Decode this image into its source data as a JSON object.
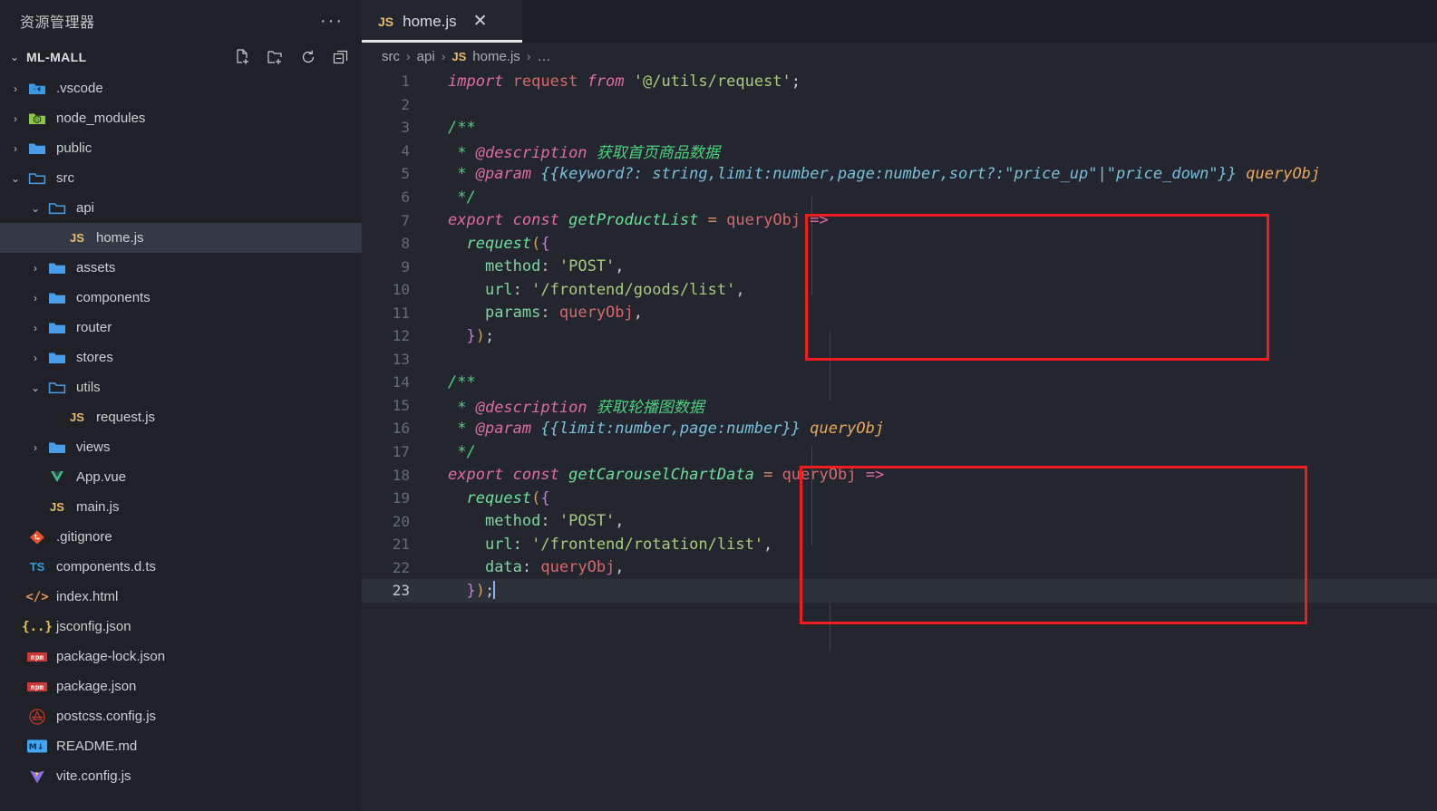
{
  "sidebar": {
    "title": "资源管理器",
    "more_label": "···",
    "root": {
      "label": "ML-MALL",
      "twisty": "⌄",
      "actions": [
        {
          "name": "new-file-icon",
          "label": "New File"
        },
        {
          "name": "new-folder-icon",
          "label": "New Folder"
        },
        {
          "name": "refresh-icon",
          "label": "Refresh Explorer"
        },
        {
          "name": "collapse-all-icon",
          "label": "Collapse Folders in Explorer"
        }
      ]
    },
    "items": [
      {
        "label": ".vscode",
        "icon": "vscode-folder-icon",
        "indent": 1,
        "twisty": "›",
        "type": "folder",
        "selected": false
      },
      {
        "label": "node_modules",
        "icon": "node-folder-icon",
        "indent": 1,
        "twisty": "›",
        "type": "folder",
        "selected": false
      },
      {
        "label": "public",
        "icon": "folder-icon",
        "indent": 1,
        "twisty": "›",
        "type": "folder",
        "selected": false
      },
      {
        "label": "src",
        "icon": "folder-open-icon",
        "indent": 1,
        "twisty": "⌄",
        "type": "folder",
        "selected": false
      },
      {
        "label": "api",
        "icon": "folder-open-icon",
        "indent": 2,
        "twisty": "⌄",
        "type": "folder",
        "selected": false
      },
      {
        "label": "home.js",
        "icon": "js-file-icon",
        "indent": 3,
        "twisty": "",
        "type": "file",
        "selected": true
      },
      {
        "label": "assets",
        "icon": "folder-icon",
        "indent": 2,
        "twisty": "›",
        "type": "folder",
        "selected": false
      },
      {
        "label": "components",
        "icon": "folder-icon",
        "indent": 2,
        "twisty": "›",
        "type": "folder",
        "selected": false
      },
      {
        "label": "router",
        "icon": "folder-icon",
        "indent": 2,
        "twisty": "›",
        "type": "folder",
        "selected": false
      },
      {
        "label": "stores",
        "icon": "folder-icon",
        "indent": 2,
        "twisty": "›",
        "type": "folder",
        "selected": false
      },
      {
        "label": "utils",
        "icon": "folder-open-icon",
        "indent": 2,
        "twisty": "⌄",
        "type": "folder",
        "selected": false
      },
      {
        "label": "request.js",
        "icon": "js-file-icon",
        "indent": 3,
        "twisty": "",
        "type": "file",
        "selected": false
      },
      {
        "label": "views",
        "icon": "folder-icon",
        "indent": 2,
        "twisty": "›",
        "type": "folder",
        "selected": false
      },
      {
        "label": "App.vue",
        "icon": "vue-file-icon",
        "indent": 2,
        "twisty": "",
        "type": "file",
        "selected": false
      },
      {
        "label": "main.js",
        "icon": "js-file-icon",
        "indent": 2,
        "twisty": "",
        "type": "file",
        "selected": false
      },
      {
        "label": ".gitignore",
        "icon": "git-file-icon",
        "indent": 1,
        "twisty": "",
        "type": "file",
        "selected": false
      },
      {
        "label": "components.d.ts",
        "icon": "ts-file-icon",
        "indent": 1,
        "twisty": "",
        "type": "file",
        "selected": false
      },
      {
        "label": "index.html",
        "icon": "html-file-icon",
        "indent": 1,
        "twisty": "",
        "type": "file",
        "selected": false
      },
      {
        "label": "jsconfig.json",
        "icon": "json-file-icon",
        "indent": 1,
        "twisty": "",
        "type": "file",
        "selected": false
      },
      {
        "label": "package-lock.json",
        "icon": "npm-file-icon",
        "indent": 1,
        "twisty": "",
        "type": "file",
        "selected": false
      },
      {
        "label": "package.json",
        "icon": "npm-file-icon",
        "indent": 1,
        "twisty": "",
        "type": "file",
        "selected": false
      },
      {
        "label": "postcss.config.js",
        "icon": "postcss-file-icon",
        "indent": 1,
        "twisty": "",
        "type": "file",
        "selected": false
      },
      {
        "label": "README.md",
        "icon": "markdown-file-icon",
        "indent": 1,
        "twisty": "",
        "type": "file",
        "selected": false
      },
      {
        "label": "vite.config.js",
        "icon": "vite-file-icon",
        "indent": 1,
        "twisty": "",
        "type": "file",
        "selected": false
      }
    ]
  },
  "editor": {
    "tabs": [
      {
        "label": "home.js",
        "badge": "JS",
        "close": "✕",
        "active": true
      }
    ],
    "breadcrumb": [
      {
        "text": "src",
        "type": "crumb"
      },
      {
        "text": "›",
        "type": "sep"
      },
      {
        "text": "api",
        "type": "crumb"
      },
      {
        "text": "›",
        "type": "sep"
      },
      {
        "text": "JS",
        "type": "badge"
      },
      {
        "text": "home.js",
        "type": "crumb"
      },
      {
        "text": "›",
        "type": "sep"
      },
      {
        "text": "…",
        "type": "crumb"
      }
    ],
    "active_line": 23,
    "lines": [
      {
        "n": "1",
        "text": "import request from '@/utils/request';"
      },
      {
        "n": "2",
        "text": ""
      },
      {
        "n": "3",
        "text": "/**"
      },
      {
        "n": "4",
        "text": " * @description 获取首页商品数据"
      },
      {
        "n": "5",
        "text": " * @param {{keyword?: string,limit:number,page:number,sort?:\"price_up\"|\"price_down\"}} queryObj"
      },
      {
        "n": "6",
        "text": " */"
      },
      {
        "n": "7",
        "text": "export const getProductList = queryObj =>"
      },
      {
        "n": "8",
        "text": "  request({"
      },
      {
        "n": "9",
        "text": "    method: 'POST',"
      },
      {
        "n": "10",
        "text": "    url: '/frontend/goods/list',"
      },
      {
        "n": "11",
        "text": "    params: queryObj,"
      },
      {
        "n": "12",
        "text": "  });"
      },
      {
        "n": "13",
        "text": ""
      },
      {
        "n": "14",
        "text": "/**"
      },
      {
        "n": "15",
        "text": " * @description 获取轮播图数据"
      },
      {
        "n": "16",
        "text": " * @param {{limit:number,page:number}} queryObj"
      },
      {
        "n": "17",
        "text": " */"
      },
      {
        "n": "18",
        "text": "export const getCarouselChartData = queryObj =>"
      },
      {
        "n": "19",
        "text": "  request({"
      },
      {
        "n": "20",
        "text": "    method: 'POST',"
      },
      {
        "n": "21",
        "text": "    url: '/frontend/rotation/list',"
      },
      {
        "n": "22",
        "text": "    data: queryObj,"
      },
      {
        "n": "23",
        "text": "  });"
      }
    ]
  },
  "annotations": [
    {
      "name": "highlight-box-get-product-list",
      "color": "#f01c22",
      "covers_lines": "7-12"
    },
    {
      "name": "highlight-box-get-carousel-chart-data",
      "color": "#f01c22",
      "covers_lines": "18-23"
    }
  ],
  "colors": {
    "sidebar_bg": "#1f2127",
    "editor_bg": "#23262e",
    "tabbar_bg": "#1e2025",
    "selection_bg": "#333a45",
    "active_line_bg": "#2d313a",
    "annotation_red": "#f01c22",
    "js_badge": "#e8bb6d"
  }
}
